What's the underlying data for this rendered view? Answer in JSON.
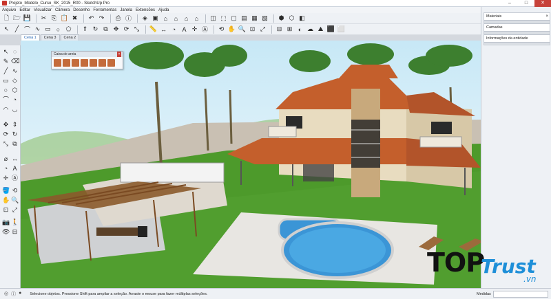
{
  "window": {
    "title": "Projeto_Modelo_Curso_SK_2015_R00 - SketchUp Pro"
  },
  "menu": {
    "items": [
      "Arquivo",
      "Editar",
      "Visualizar",
      "Câmera",
      "Desenho",
      "Ferramentas",
      "Janela",
      "Extensões",
      "Ajuda"
    ]
  },
  "scene_tabs": [
    "Cena 1",
    "Cena 3",
    "Cena 2"
  ],
  "floating_tray": {
    "title": "Caixa de areia"
  },
  "right_panel": {
    "trays": [
      "Materiais",
      "Camadas",
      "Informações da entidade"
    ]
  },
  "status": {
    "message": "Selecione objetos. Pressione Shift para ampliar a seleção. Arraste o mouse para fazer múltiplas seleções.",
    "measurements_label": "Medidas"
  },
  "watermark": {
    "brand_top": "TOP",
    "brand_trust": "Trust",
    "brand_domain": ".vn"
  },
  "colors": {
    "roof": "#c45f2c",
    "grass": "#4d9a2b",
    "wall": "#e8dcc0",
    "sky": "#c7e8f6",
    "brand_blue": "#1e8fd8"
  }
}
